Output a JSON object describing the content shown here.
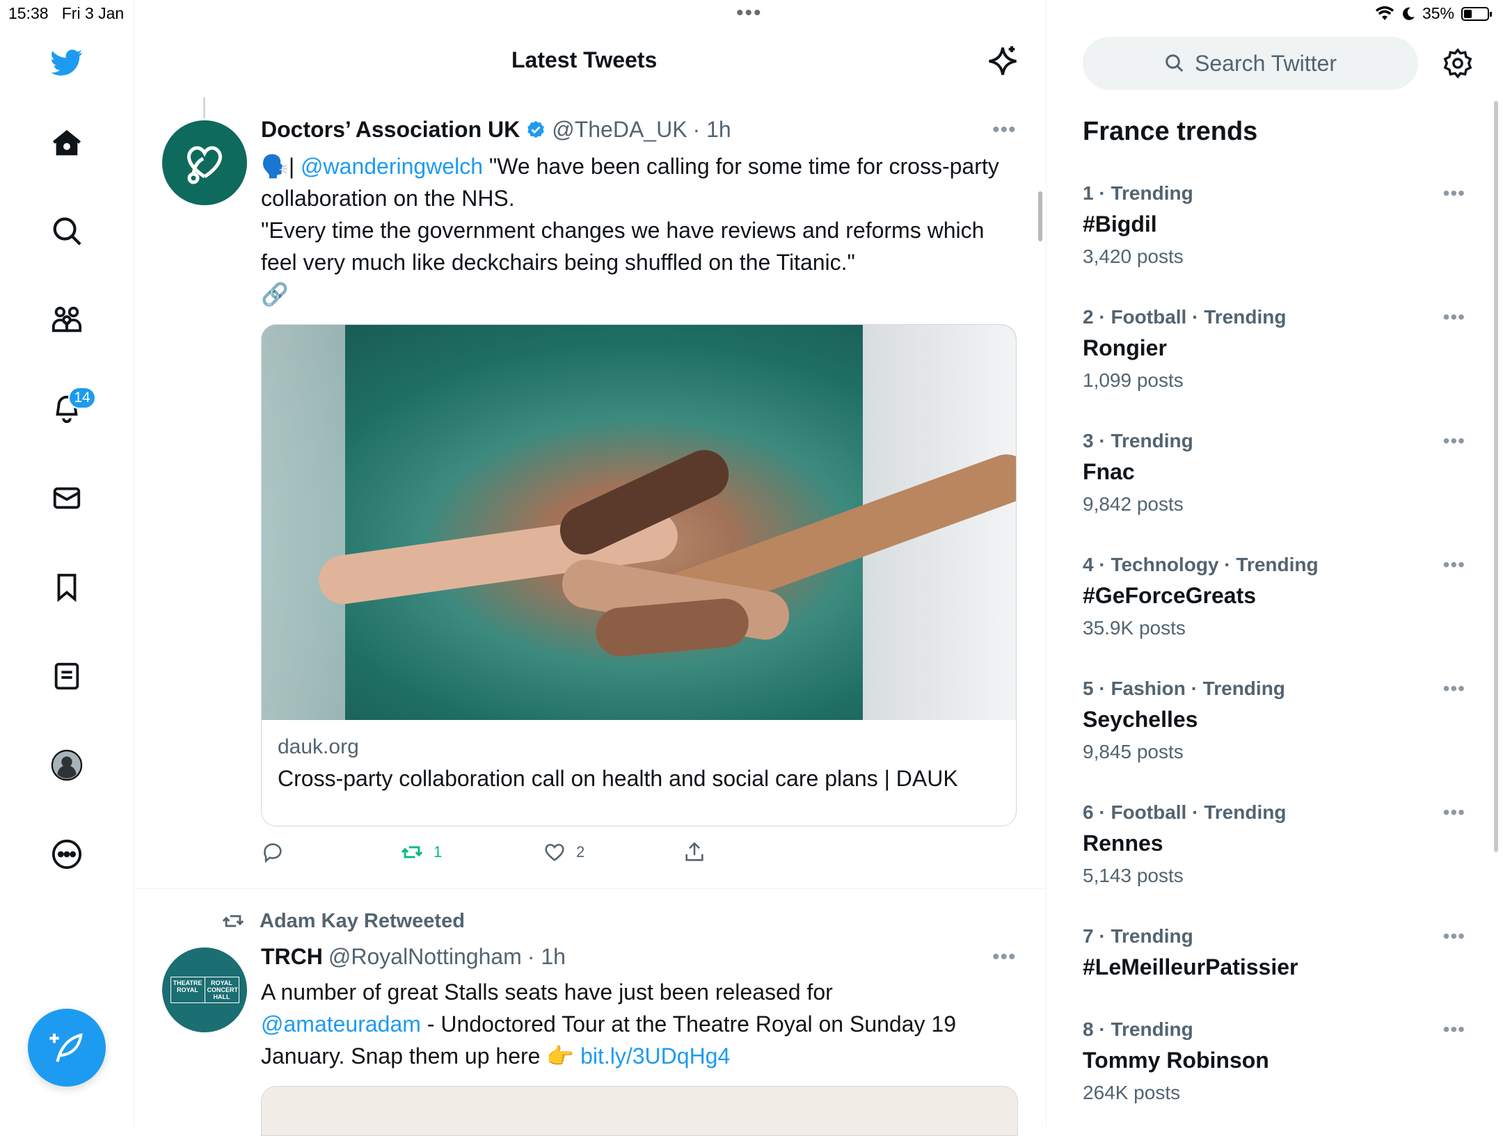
{
  "status": {
    "time": "15:38",
    "date": "Fri 3 Jan",
    "battery": "35%",
    "battery_level": 0.35
  },
  "nav": {
    "notifications_badge": "14",
    "items": [
      "twitter-logo-icon",
      "home-icon",
      "explore-icon",
      "communities-icon",
      "notifications-icon",
      "messages-icon",
      "bookmarks-icon",
      "lists-icon",
      "profile-icon",
      "more-icon"
    ]
  },
  "main": {
    "title": "Latest Tweets"
  },
  "tweet1": {
    "name": "Doctors’ Association UK",
    "handle": "@TheDA_UK",
    "time": "· 1h",
    "emoji_prefix": "🗣️|",
    "mention": "@wanderingwelch",
    "text_part1": " \"We have been calling for some time for cross-party collaboration on the NHS.",
    "text_part2": "\"Every time the government changes we have reviews and reforms which feel very much like deckchairs being shuffled on the Titanic.\"",
    "link_emoji": "🔗",
    "card_domain": "dauk.org",
    "card_title": "Cross-party collaboration call on health and social care plans | DAUK",
    "retweets": "1",
    "likes": "2"
  },
  "tweet2": {
    "retweeted_by": "Adam Kay Retweeted",
    "name": "TRCH",
    "handle": "@RoyalNottingham",
    "time": "· 1h",
    "avatar_text_1": "THEATRE ROYAL",
    "avatar_text_2": "ROYAL CONCERT HALL",
    "text_part1": "A number of great Stalls seats have just been released for ",
    "mention": "@amateuradam",
    "text_part2": " - Undoctored Tour at the Theatre Royal on Sunday 19 January. Snap them up here 👉 ",
    "link": "bit.ly/3UDqHg4"
  },
  "sidebar": {
    "search_placeholder": "Search Twitter",
    "trends_title": "France trends",
    "trends": [
      {
        "meta": "1 · Trending",
        "name": "#Bigdil",
        "posts": "3,420 posts"
      },
      {
        "meta": "2 · Football · Trending",
        "name": "Rongier",
        "posts": "1,099 posts"
      },
      {
        "meta": "3 · Trending",
        "name": "Fnac",
        "posts": "9,842 posts"
      },
      {
        "meta": "4 · Technology · Trending",
        "name": "#GeForceGreats",
        "posts": "35.9K posts"
      },
      {
        "meta": "5 · Fashion · Trending",
        "name": "Seychelles",
        "posts": "9,845 posts"
      },
      {
        "meta": "6 · Football · Trending",
        "name": "Rennes",
        "posts": "5,143 posts"
      },
      {
        "meta": "7 · Trending",
        "name": "#LeMeilleurPatissier",
        "posts": ""
      },
      {
        "meta": "8 · Trending",
        "name": "Tommy Robinson",
        "posts": "264K posts"
      }
    ]
  },
  "colors": {
    "accent": "#1d9bf0",
    "retweet_green": "#00ba7c",
    "dauk_teal": "#0e6a5c"
  }
}
